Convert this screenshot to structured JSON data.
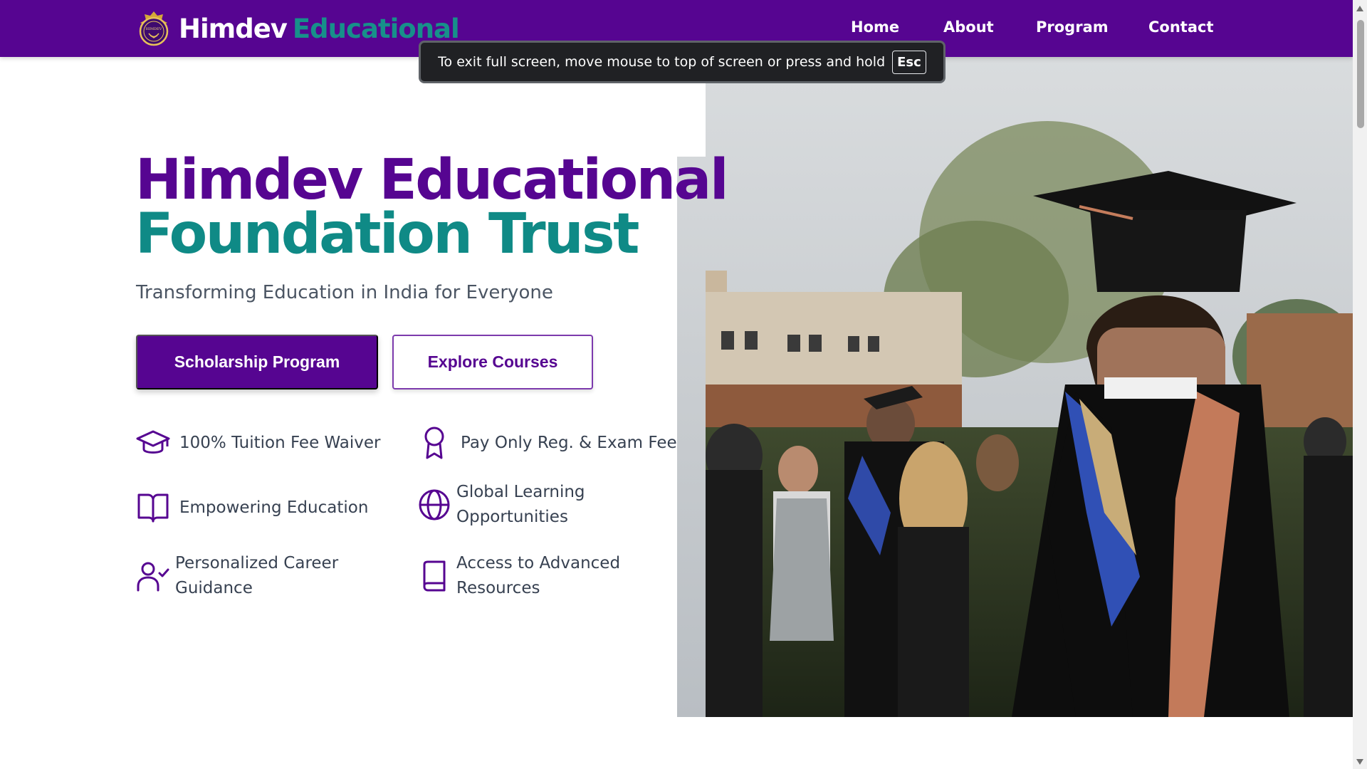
{
  "nav": {
    "brand_part1": "Himdev",
    "brand_part2": "Educational",
    "logo_text": "HIMDEV",
    "links": [
      "Home",
      "About",
      "Program",
      "Contact"
    ]
  },
  "fullscreen_notice": {
    "message": "To exit full screen, move mouse to top of screen or press and hold",
    "key": "Esc"
  },
  "hero": {
    "title_line1": "Himdev Educational",
    "title_line2": "Foundation Trust",
    "subtitle": "Transforming Education in India for Everyone",
    "primary_button": "Scholarship Program",
    "secondary_button": "Explore Courses",
    "features": [
      {
        "icon": "graduation-cap-icon",
        "text": "100% Tuition Fee Waiver"
      },
      {
        "icon": "award-ribbon-icon",
        "text": "Pay Only Reg. & Exam Fee"
      },
      {
        "icon": "open-book-icon",
        "text": "Empowering Education"
      },
      {
        "icon": "globe-icon",
        "text": "Global Learning Opportunities"
      },
      {
        "icon": "user-check-icon",
        "text": "Personalized Career Guidance"
      },
      {
        "icon": "book-icon",
        "text": "Access to Advanced Resources"
      }
    ]
  },
  "colors": {
    "primary": "#560591",
    "accent": "#0f8a86",
    "text": "#374151"
  }
}
